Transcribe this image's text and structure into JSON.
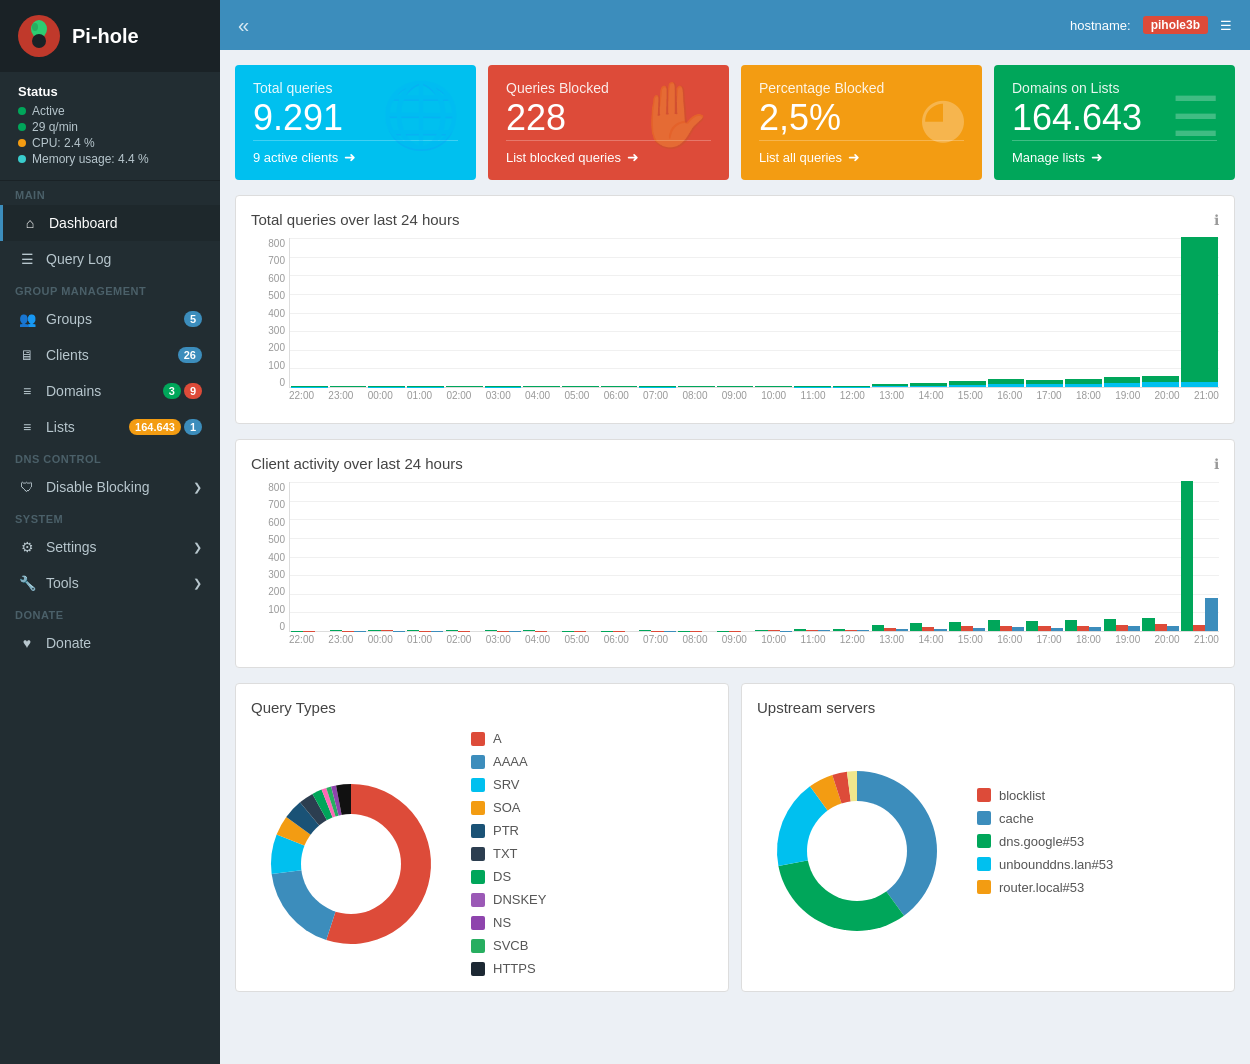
{
  "app": {
    "title": "Pi-hole",
    "hostname_label": "hostname:",
    "hostname_value": "pihole3b"
  },
  "sidebar": {
    "status": {
      "title": "Status",
      "items": [
        {
          "label": "Active",
          "color": "green"
        },
        {
          "label": "29 q/min",
          "color": "green"
        },
        {
          "label": "CPU: 2.4 %",
          "color": "yellow"
        },
        {
          "label": "Memory usage: 4.4 %",
          "color": "teal"
        }
      ]
    },
    "sections": [
      {
        "label": "MAIN",
        "items": [
          {
            "id": "dashboard",
            "label": "Dashboard",
            "icon": "⌂",
            "active": true,
            "badge": null
          },
          {
            "id": "query-log",
            "label": "Query Log",
            "icon": "☰",
            "active": false,
            "badge": null
          }
        ]
      },
      {
        "label": "GROUP MANAGEMENT",
        "items": [
          {
            "id": "groups",
            "label": "Groups",
            "icon": "👥",
            "active": false,
            "badge": "5",
            "badge_color": "blue"
          },
          {
            "id": "clients",
            "label": "Clients",
            "icon": "🖥",
            "active": false,
            "badge": "26",
            "badge_color": "blue"
          },
          {
            "id": "domains",
            "label": "Domains",
            "icon": "≡",
            "active": false,
            "badge1": "3",
            "badge1_color": "green",
            "badge2": "9",
            "badge2_color": "red",
            "multi_badge": true
          },
          {
            "id": "lists",
            "label": "Lists",
            "icon": "≡",
            "active": false,
            "badge": "164.643",
            "badge_color": "orange",
            "badge2": "1",
            "badge2_color": "blue",
            "multi_badge": true
          }
        ]
      },
      {
        "label": "DNS CONTROL",
        "items": [
          {
            "id": "disable-blocking",
            "label": "Disable Blocking",
            "icon": "🛡",
            "active": false,
            "has_chevron": true
          }
        ]
      },
      {
        "label": "SYSTEM",
        "items": [
          {
            "id": "settings",
            "label": "Settings",
            "icon": "⚙",
            "active": false,
            "has_chevron": true
          },
          {
            "id": "tools",
            "label": "Tools",
            "icon": "🔧",
            "active": false,
            "has_chevron": true
          }
        ]
      },
      {
        "label": "DONATE",
        "items": [
          {
            "id": "donate",
            "label": "Donate",
            "icon": "♥",
            "active": false
          }
        ]
      }
    ]
  },
  "stat_cards": [
    {
      "id": "total-queries",
      "title": "Total queries",
      "value": "9.291",
      "footer": "9 active clients",
      "color": "cyan",
      "icon": "🌐"
    },
    {
      "id": "queries-blocked",
      "title": "Queries Blocked",
      "value": "228",
      "footer": "List blocked queries",
      "color": "red",
      "icon": "✋"
    },
    {
      "id": "percentage-blocked",
      "title": "Percentage Blocked",
      "value": "2,5%",
      "footer": "List all queries",
      "color": "orange",
      "icon": "◕"
    },
    {
      "id": "domains-on-lists",
      "title": "Domains on Lists",
      "value": "164.643",
      "footer": "Manage lists",
      "color": "green",
      "icon": "☰"
    }
  ],
  "charts": {
    "total_queries": {
      "title": "Total queries over last 24 hours",
      "y_labels": [
        "800",
        "700",
        "600",
        "500",
        "400",
        "300",
        "200",
        "100",
        "0"
      ],
      "x_labels": [
        "22:00",
        "23:00",
        "00:00",
        "01:00",
        "02:00",
        "03:00",
        "04:00",
        "05:00",
        "06:00",
        "07:00",
        "08:00",
        "09:00",
        "10:00",
        "11:00",
        "12:00",
        "13:00",
        "14:00",
        "15:00",
        "16:00",
        "17:00",
        "18:00",
        "19:00",
        "20:00",
        "21:00"
      ],
      "bars": [
        [
          2,
          1
        ],
        [
          1,
          0
        ],
        [
          3,
          1
        ],
        [
          2,
          1
        ],
        [
          1,
          0
        ],
        [
          2,
          1
        ],
        [
          1,
          0
        ],
        [
          1,
          0
        ],
        [
          1,
          0
        ],
        [
          2,
          1
        ],
        [
          1,
          0
        ],
        [
          1,
          0
        ],
        [
          1,
          0
        ],
        [
          3,
          1
        ],
        [
          2,
          1
        ],
        [
          15,
          5
        ],
        [
          20,
          7
        ],
        [
          35,
          12
        ],
        [
          45,
          18
        ],
        [
          38,
          15
        ],
        [
          42,
          17
        ],
        [
          55,
          20
        ],
        [
          60,
          25
        ],
        [
          820,
          30
        ]
      ]
    },
    "client_activity": {
      "title": "Client activity over last 24 hours",
      "y_labels": [
        "800",
        "700",
        "600",
        "500",
        "400",
        "300",
        "200",
        "100",
        "0"
      ],
      "x_labels": [
        "22:00",
        "23:00",
        "00:00",
        "01:00",
        "02:00",
        "03:00",
        "04:00",
        "05:00",
        "06:00",
        "07:00",
        "08:00",
        "09:00",
        "10:00",
        "11:00",
        "12:00",
        "13:00",
        "14:00",
        "15:00",
        "16:00",
        "17:00",
        "18:00",
        "19:00",
        "20:00",
        "21:00"
      ],
      "bars": [
        [
          2,
          1,
          0
        ],
        [
          3,
          2,
          1
        ],
        [
          8,
          3,
          2
        ],
        [
          5,
          2,
          1
        ],
        [
          3,
          1,
          0
        ],
        [
          4,
          2,
          1
        ],
        [
          3,
          1,
          0
        ],
        [
          2,
          1,
          0
        ],
        [
          2,
          1,
          0
        ],
        [
          3,
          2,
          1
        ],
        [
          2,
          1,
          0
        ],
        [
          2,
          1,
          0
        ],
        [
          8,
          4,
          2
        ],
        [
          10,
          5,
          3
        ],
        [
          12,
          6,
          4
        ],
        [
          35,
          18,
          10
        ],
        [
          42,
          20,
          12
        ],
        [
          50,
          25,
          15
        ],
        [
          60,
          30,
          20
        ],
        [
          55,
          28,
          18
        ],
        [
          58,
          30,
          22
        ],
        [
          65,
          35,
          25
        ],
        [
          70,
          40,
          30
        ],
        [
          820,
          35,
          180
        ]
      ]
    }
  },
  "query_types": {
    "title": "Query Types",
    "legend": [
      {
        "label": "A",
        "color": "#dd4b39"
      },
      {
        "label": "AAAA",
        "color": "#3c8dbc"
      },
      {
        "label": "SRV",
        "color": "#00c0ef"
      },
      {
        "label": "SOA",
        "color": "#f39c12"
      },
      {
        "label": "PTR",
        "color": "#3c8dbc"
      },
      {
        "label": "TXT",
        "color": "#222"
      },
      {
        "label": "DS",
        "color": "#00a65a"
      },
      {
        "label": "DNSKEY",
        "color": "#9b59b6"
      },
      {
        "label": "NS",
        "color": "#8e44ad"
      },
      {
        "label": "SVCB",
        "color": "#27ae60"
      },
      {
        "label": "HTTPS",
        "color": "#2c3e50"
      }
    ],
    "segments": [
      {
        "percent": 55,
        "color": "#dd4b39",
        "start": 0
      },
      {
        "percent": 18,
        "color": "#3c8dbc",
        "start": 55
      },
      {
        "percent": 8,
        "color": "#00c0ef",
        "start": 73
      },
      {
        "percent": 5,
        "color": "#f39c12",
        "start": 81
      },
      {
        "percent": 5,
        "color": "#1a5276",
        "start": 86
      },
      {
        "percent": 3,
        "color": "#222",
        "start": 91
      },
      {
        "percent": 2,
        "color": "#00a65a",
        "start": 94
      },
      {
        "percent": 1,
        "color": "#ff69b4",
        "start": 96
      },
      {
        "percent": 1,
        "color": "#27ae60",
        "start": 97
      },
      {
        "percent": 7,
        "color": "#111",
        "start": 98
      }
    ]
  },
  "upstream_servers": {
    "title": "Upstream servers",
    "legend": [
      {
        "label": "blocklist",
        "color": "#dd4b39"
      },
      {
        "label": "cache",
        "color": "#3c8dbc"
      },
      {
        "label": "dns.google#53",
        "color": "#00a65a"
      },
      {
        "label": "unbounddns.lan#53",
        "color": "#00c0ef"
      },
      {
        "label": "router.local#53",
        "color": "#f39c12"
      }
    ],
    "segments": [
      {
        "percent": 45,
        "color": "#3c8dbc"
      },
      {
        "percent": 30,
        "color": "#00a65a"
      },
      {
        "percent": 15,
        "color": "#00c0ef"
      },
      {
        "percent": 5,
        "color": "#f39c12"
      },
      {
        "percent": 3,
        "color": "#dd4b39"
      },
      {
        "percent": 2,
        "color": "#f0e68c"
      }
    ]
  }
}
